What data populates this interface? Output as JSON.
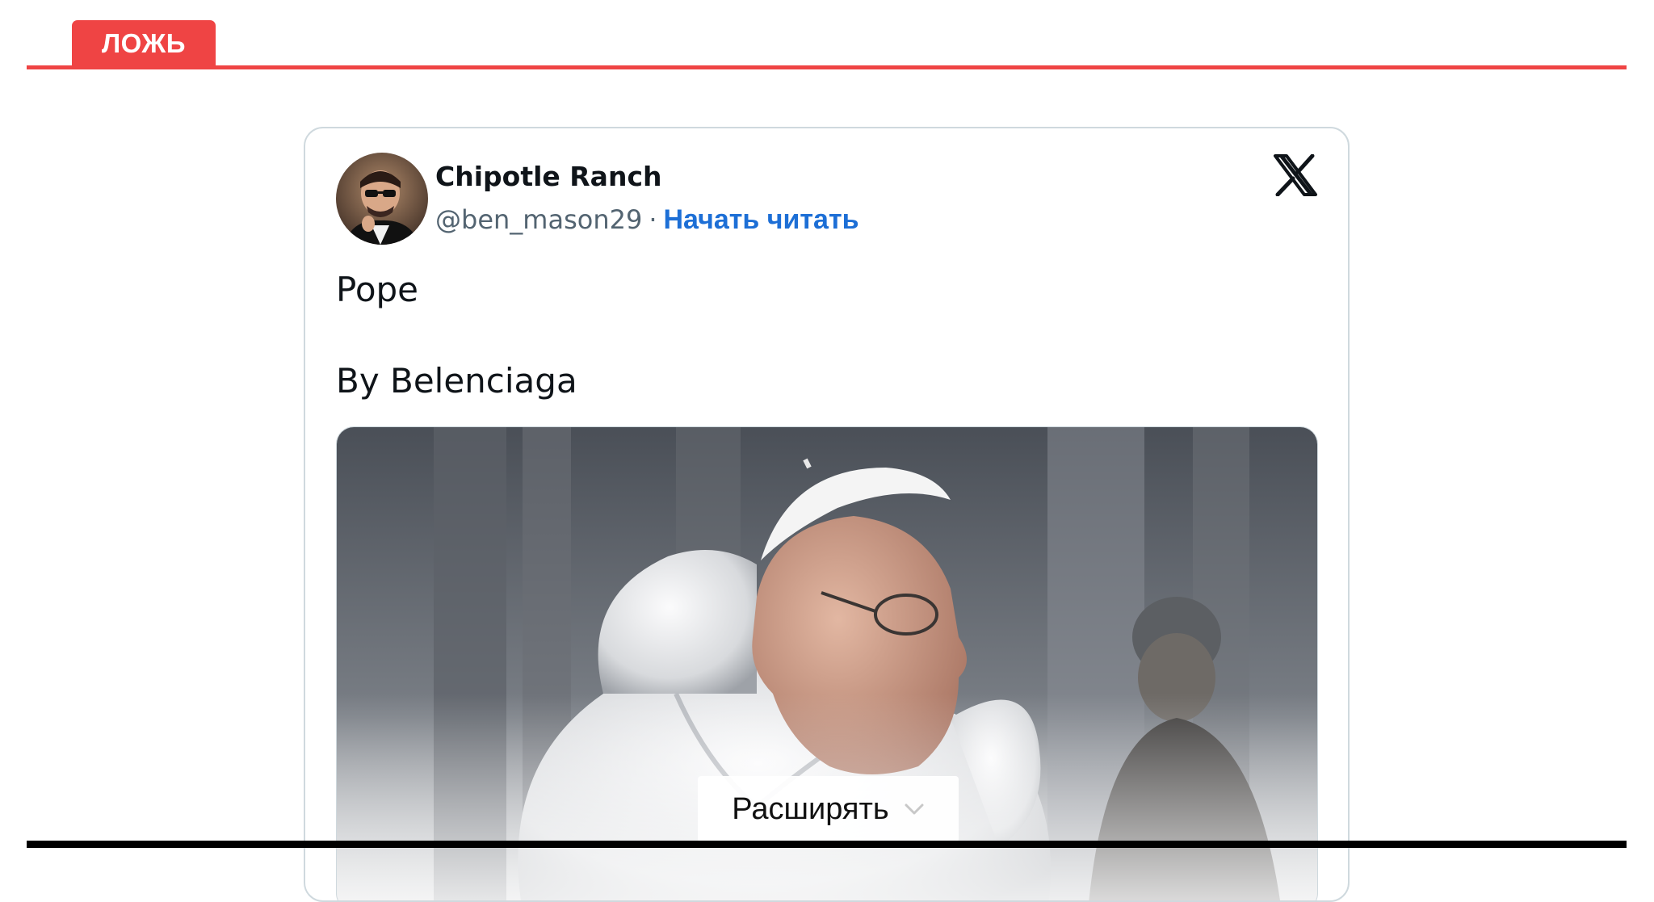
{
  "verdict": {
    "label": "ЛОЖЬ",
    "color": "#ef4444"
  },
  "tweet": {
    "author_name": "Chipotle Ranch",
    "handle": "@ben_mason29",
    "separator": "·",
    "follow_label": "Начать читать",
    "text_lines": [
      "Pope",
      "By Belenciaga"
    ],
    "platform_icon": "x-logo-icon",
    "media_alt_icon": "photo",
    "expand_label": "Расширять"
  },
  "colors": {
    "link": "#1d6fd6",
    "border": "#cfd9de",
    "text": "#0f1419",
    "muted": "#536471"
  }
}
